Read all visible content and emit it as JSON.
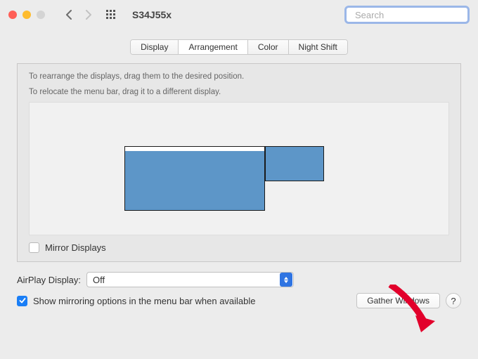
{
  "window": {
    "title": "S34J55x",
    "search_placeholder": "Search"
  },
  "tabs": {
    "display": "Display",
    "arrangement": "Arrangement",
    "color": "Color",
    "night_shift": "Night Shift"
  },
  "panel": {
    "instruction_line1": "To rearrange the displays, drag them to the desired position.",
    "instruction_line2": "To relocate the menu bar, drag it to a different display.",
    "mirror_label": "Mirror Displays"
  },
  "airplay": {
    "label": "AirPlay Display:",
    "value": "Off"
  },
  "footer": {
    "show_mirror_label": "Show mirroring options in the menu bar when available",
    "gather_label": "Gather Windows",
    "help_label": "?"
  }
}
